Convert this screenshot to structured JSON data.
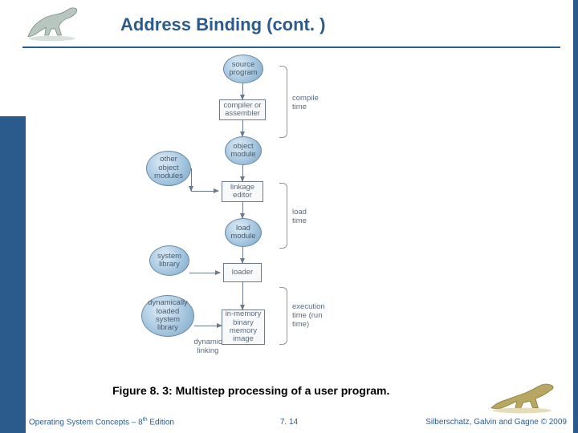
{
  "title": "Address Binding (cont. )",
  "caption": "Figure 8. 3:  Multistep processing of a user program.",
  "footer": {
    "left_pre": "Operating System Concepts – 8",
    "left_sup": "th",
    "left_post": " Edition",
    "center": "7. 14",
    "right": "Silberschatz, Galvin and Gagne © 2009"
  },
  "diagram": {
    "nodes": {
      "source": "source\nprogram",
      "compiler": "compiler or\nassembler",
      "objmod": "object\nmodule",
      "otherobj": "other\nobject\nmodules",
      "linkage": "linkage\neditor",
      "loadmod": "load\nmodule",
      "syslib": "system\nlibrary",
      "loader": "loader",
      "dynlib": "dynamically\nloaded\nsystem\nlibrary",
      "memimg": "in-memory\nbinary\nmemory\nimage"
    },
    "side_label": "dynamic\nlinking",
    "brackets": {
      "compile": "compile\ntime",
      "load": "load\ntime",
      "exec": "execution\ntime (run\ntime)"
    }
  }
}
